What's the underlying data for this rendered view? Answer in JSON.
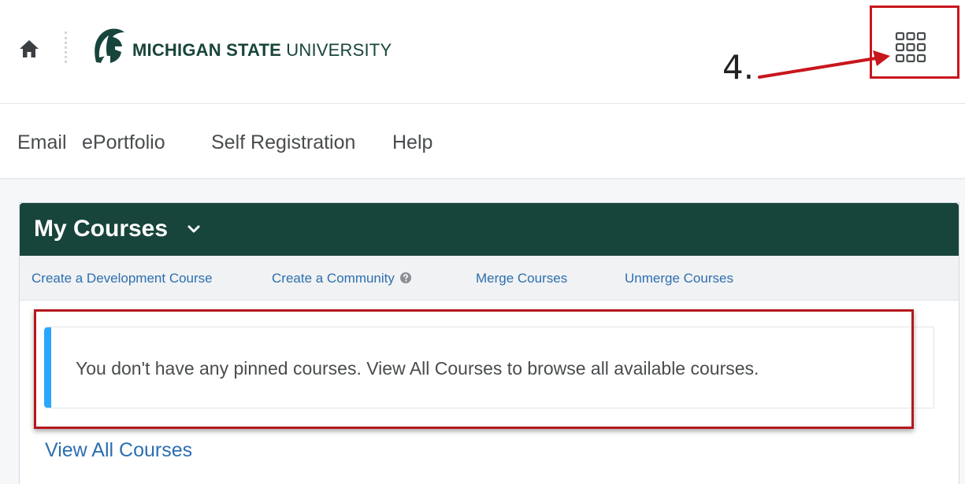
{
  "header": {
    "university_bold": "MICHIGAN STATE",
    "university_light": "UNIVERSITY",
    "annotation_label": "4.",
    "icons": {
      "home": "home-icon",
      "logo": "spartan-helmet-icon",
      "apps": "waffle-grid-icon"
    }
  },
  "nav": {
    "items": [
      {
        "label": "Email"
      },
      {
        "label": "ePortfolio"
      },
      {
        "label": "Self Registration"
      },
      {
        "label": "Help"
      }
    ]
  },
  "widget": {
    "title": "My Courses",
    "actions": [
      {
        "label": "Create a Development Course"
      },
      {
        "label": "Create a Community"
      },
      {
        "label": "Merge Courses"
      },
      {
        "label": "Unmerge Courses"
      }
    ],
    "alert_text": "You don't have any pinned courses. View All Courses to browse all available courses.",
    "view_all_label": "View All Courses"
  },
  "colors": {
    "brand_green": "#18453b",
    "link_blue": "#2c6fb0",
    "alert_accent": "#29a6ff",
    "annotation_red": "#c8161d"
  }
}
